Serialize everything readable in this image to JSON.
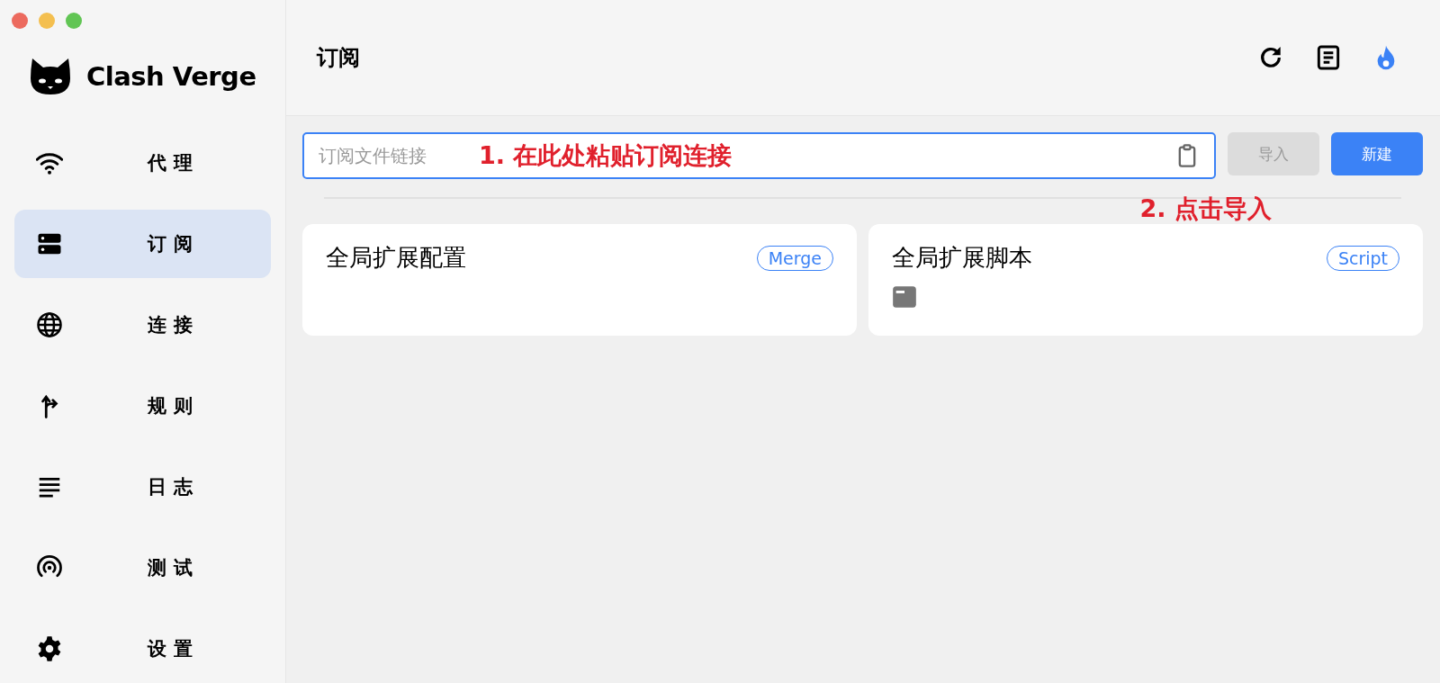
{
  "app": {
    "name": "Clash Verge"
  },
  "nav": [
    {
      "label": "代理",
      "selected": false
    },
    {
      "label": "订阅",
      "selected": true
    },
    {
      "label": "连接",
      "selected": false
    },
    {
      "label": "规则",
      "selected": false
    },
    {
      "label": "日志",
      "selected": false
    },
    {
      "label": "测试",
      "selected": false
    },
    {
      "label": "设置",
      "selected": false
    }
  ],
  "page": {
    "title": "订阅"
  },
  "url_field": {
    "placeholder": "订阅文件链接"
  },
  "import_button": {
    "label": "导入",
    "disabled": true
  },
  "new_button": {
    "label": "新建"
  },
  "annotations": [
    "1. 在此处粘贴订阅连接",
    "2. 点击导入"
  ],
  "cards": [
    {
      "name": "全局扩展配置",
      "tag": "Merge",
      "has_icon": false
    },
    {
      "name": "全局扩展脚本",
      "tag": "Script",
      "has_icon": true
    }
  ]
}
